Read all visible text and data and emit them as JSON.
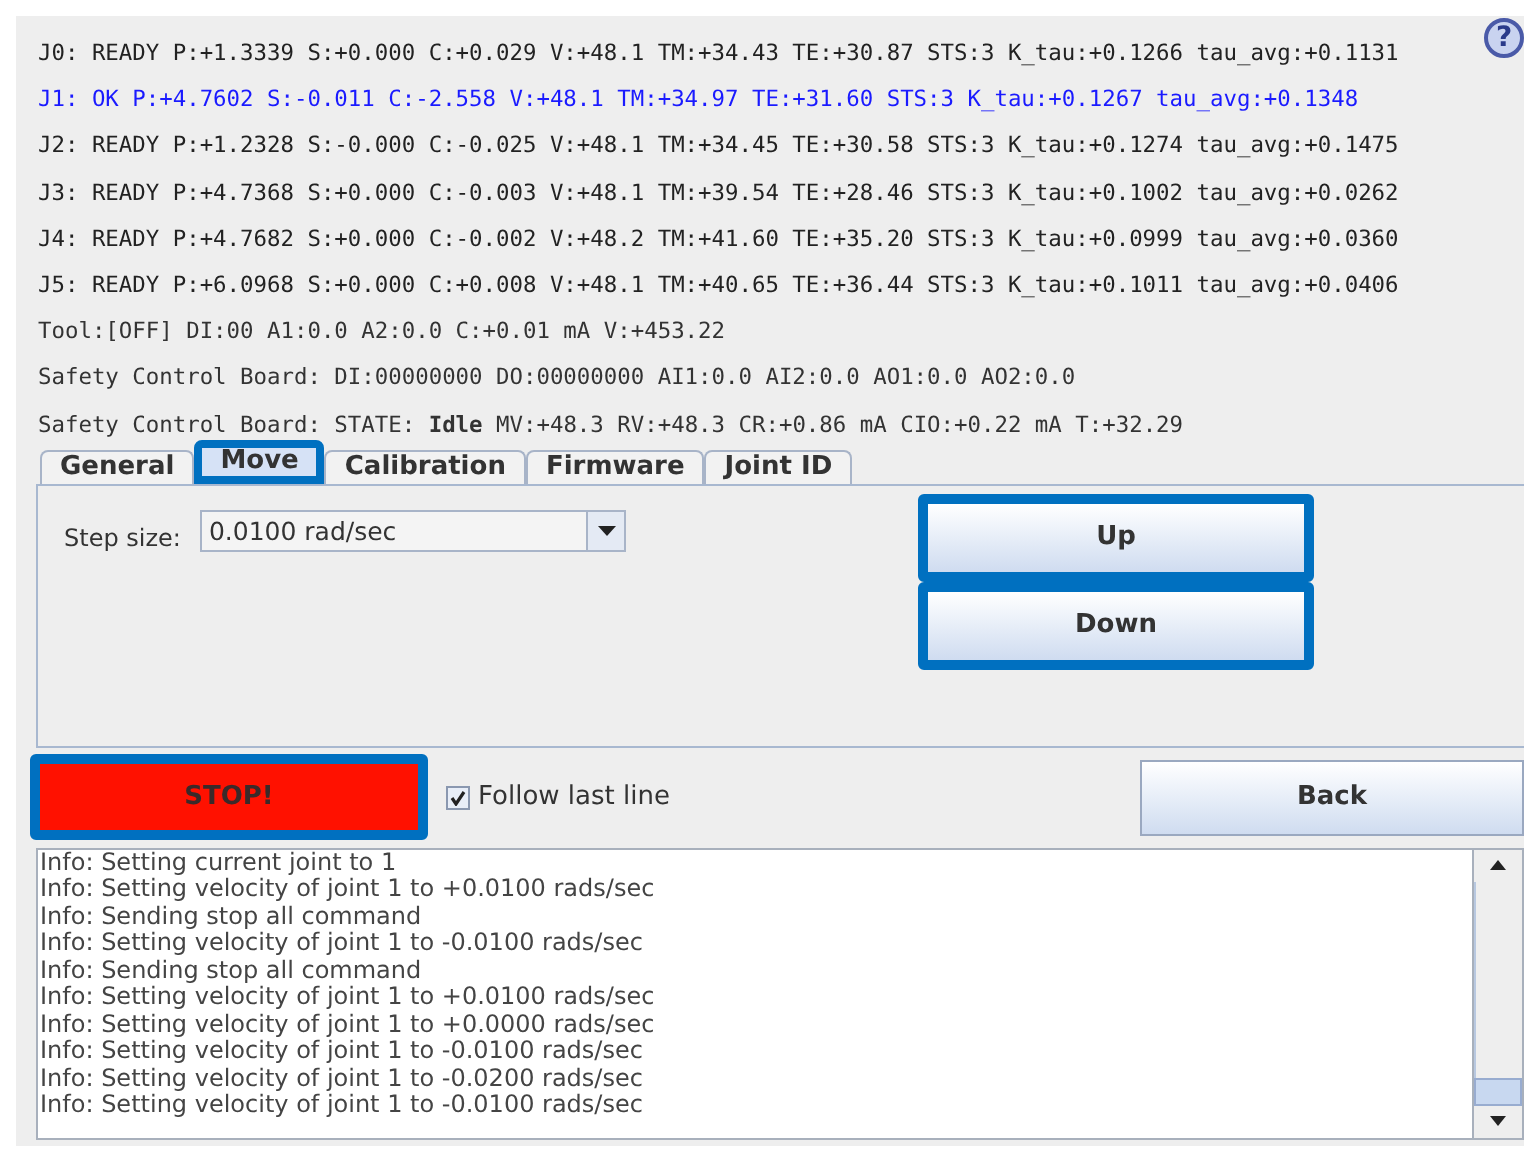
{
  "status_lines": [
    {
      "text": "J0: READY P:+1.3339 S:+0.000 C:+0.029 V:+48.1 TM:+34.43 TE:+30.87 STS:3 K_tau:+0.1266 tau_avg:+0.1131",
      "color": "#222222"
    },
    {
      "text": "J1: OK P:+4.7602 S:-0.011 C:-2.558 V:+48.1 TM:+34.97 TE:+31.60 STS:3 K_tau:+0.1267 tau_avg:+0.1348",
      "color": "#1a1aff"
    },
    {
      "text": "J2: READY P:+1.2328 S:-0.000 C:-0.025 V:+48.1 TM:+34.45 TE:+30.58 STS:3 K_tau:+0.1274 tau_avg:+0.1475",
      "color": "#222222"
    },
    {
      "text": "J3: READY P:+4.7368 S:+0.000 C:-0.003 V:+48.1 TM:+39.54 TE:+28.46 STS:3 K_tau:+0.1002 tau_avg:+0.0262",
      "color": "#222222"
    },
    {
      "text": "J4: READY P:+4.7682 S:+0.000 C:-0.002 V:+48.2 TM:+41.60 TE:+35.20 STS:3 K_tau:+0.0999 tau_avg:+0.0360",
      "color": "#222222"
    },
    {
      "text": "J5: READY P:+6.0968 S:+0.000 C:+0.008 V:+48.1 TM:+40.65 TE:+36.44 STS:3 K_tau:+0.1011 tau_avg:+0.0406",
      "color": "#222222"
    },
    {
      "text": "Tool:[OFF] DI:00  A1:0.0 A2:0.0 C:+0.01 mA V:+453.22",
      "color": "#333333"
    },
    {
      "text": "Safety Control Board: DI:00000000 DO:00000000 AI1:0.0 AI2:0.0 AO1:0.0 AO2:0.0",
      "color": "#333333"
    },
    {
      "text": "Safety Control Board: STATE: **Idle** MV:+48.3 RV:+48.3 CR:+0.86 mA CIO:+0.22 mA T:+32.29",
      "color": "#333333"
    }
  ],
  "help_icon": {
    "label": "?"
  },
  "tabs": [
    {
      "label": "General",
      "selected": false,
      "highlighted": false
    },
    {
      "label": "Move",
      "selected": true,
      "highlighted": true
    },
    {
      "label": "Calibration",
      "selected": false,
      "highlighted": false
    },
    {
      "label": "Firmware",
      "selected": false,
      "highlighted": false
    },
    {
      "label": "Joint ID",
      "selected": false,
      "highlighted": false
    }
  ],
  "step_size": {
    "label": "Step size:",
    "value": "0.0100 rad/sec"
  },
  "move_buttons": [
    {
      "label": "Up",
      "highlighted": true
    },
    {
      "label": "Down",
      "highlighted": true
    }
  ],
  "stop_button": {
    "label": "STOP!",
    "highlighted": true
  },
  "follow_last_line": {
    "label": "Follow last line",
    "checked": true
  },
  "back_button": {
    "label": "Back",
    "highlighted": false
  },
  "log": [
    "Info: Setting current joint to 1",
    "Info: Setting velocity of joint 1 to +0.0100 rads/sec",
    "Info: Sending stop all command",
    "Info: Setting velocity of joint 1 to -0.0100 rads/sec",
    "Info: Sending stop all command",
    "Info: Setting velocity of joint 1 to +0.0100 rads/sec",
    "Info: Setting velocity of joint 1 to +0.0000 rads/sec",
    "Info: Setting velocity of joint 1 to -0.0100 rads/sec",
    "Info: Setting velocity of joint 1 to -0.0200 rads/sec",
    "Info: Setting velocity of joint 1 to -0.0100 rads/sec"
  ]
}
